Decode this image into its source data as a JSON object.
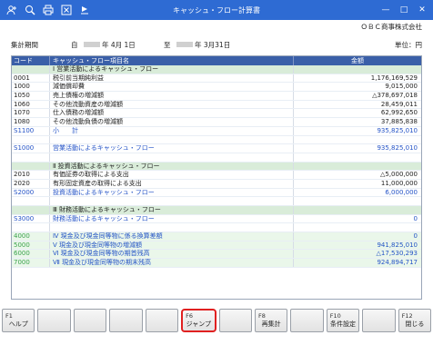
{
  "window": {
    "title": "キャッシュ・フロー計算書",
    "min_glyph": "—",
    "max_glyph": "□",
    "close_glyph": "✕"
  },
  "toolbar": {
    "icons": [
      "add-user-icon",
      "zoom-icon",
      "print-icon",
      "excel-icon",
      "settings-icon"
    ]
  },
  "company": "ＯＢＣ商事株式会社",
  "period": {
    "label": "集計期間",
    "from_prefix": "自",
    "from_suffix": "年  4月 1日",
    "to_prefix": "至",
    "to_suffix": "年  3月31日",
    "unit": "単位：円"
  },
  "table": {
    "headers": {
      "code": "コード",
      "name": "キャッシュ・フロー項目名",
      "amount": "金額"
    },
    "rows": [
      {
        "type": "head",
        "code": "",
        "name": "Ⅰ 営業活動によるキャッシュ・フロー",
        "amount": ""
      },
      {
        "type": "normal",
        "code": "0001",
        "name": "税引前当期純利益",
        "amount": "1,176,169,529"
      },
      {
        "type": "normal",
        "code": "1000",
        "name": "減価償却費",
        "amount": "9,015,000"
      },
      {
        "type": "normal",
        "code": "1050",
        "name": "売上債権の増減額",
        "amount": "△378,697,018"
      },
      {
        "type": "normal",
        "code": "1060",
        "name": "その他流動資産の増減額",
        "amount": "28,459,011"
      },
      {
        "type": "normal",
        "code": "1070",
        "name": "仕入債務の増減額",
        "amount": "62,992,650"
      },
      {
        "type": "normal",
        "code": "1080",
        "name": "その他流動負債の増減額",
        "amount": "37,885,838"
      },
      {
        "type": "total",
        "code": "S1100",
        "name": "小　　計",
        "amount": "935,825,010"
      },
      {
        "type": "blank",
        "code": "",
        "name": "",
        "amount": ""
      },
      {
        "type": "total",
        "code": "S1000",
        "name": "営業活動によるキャッシュ・フロー",
        "amount": "935,825,010"
      },
      {
        "type": "blank",
        "code": "",
        "name": "",
        "amount": ""
      },
      {
        "type": "head",
        "code": "",
        "name": "Ⅱ 投資活動によるキャッシュ・フロー",
        "amount": ""
      },
      {
        "type": "normal",
        "code": "2010",
        "name": "有価証券の取得による支出",
        "amount": "△5,000,000"
      },
      {
        "type": "normal",
        "code": "2020",
        "name": "有形固定資産の取得による支出",
        "amount": "11,000,000"
      },
      {
        "type": "total",
        "code": "S2000",
        "name": "投資活動によるキャッシュ・フロー",
        "amount": "6,000,000"
      },
      {
        "type": "blank",
        "code": "",
        "name": "",
        "amount": ""
      },
      {
        "type": "head",
        "code": "",
        "name": "Ⅲ 財務活動によるキャッシュ・フロー",
        "amount": ""
      },
      {
        "type": "total",
        "code": "S3000",
        "name": "財務活動によるキャッシュ・フロー",
        "amount": "0"
      },
      {
        "type": "blank",
        "code": "",
        "name": "",
        "amount": ""
      },
      {
        "type": "sum",
        "code": "4000",
        "name": "Ⅳ 現金及び現金同等物に係る換算差額",
        "amount": "0"
      },
      {
        "type": "sum",
        "code": "5000",
        "name": "Ⅴ 現金及び現金同等物の増減額",
        "amount": "941,825,010"
      },
      {
        "type": "sum",
        "code": "6000",
        "name": "Ⅵ 現金及び現金同等物の期首残高",
        "amount": "△17,530,293"
      },
      {
        "type": "sum",
        "code": "7000",
        "name": "Ⅶ 現金及び現金同等物の期末残高",
        "amount": "924,894,717"
      }
    ]
  },
  "fkeys": [
    {
      "key": "F1",
      "label": "ヘルプ"
    },
    {
      "key": "",
      "label": ""
    },
    {
      "key": "",
      "label": ""
    },
    {
      "key": "",
      "label": ""
    },
    {
      "key": "",
      "label": ""
    },
    {
      "key": "F6",
      "label": "ジャンプ"
    },
    {
      "key": "",
      "label": ""
    },
    {
      "key": "F8",
      "label": "再集計"
    },
    {
      "key": "",
      "label": ""
    },
    {
      "key": "F10",
      "label": "条件設定"
    },
    {
      "key": "",
      "label": ""
    },
    {
      "key": "F12",
      "label": "閉じる"
    }
  ]
}
